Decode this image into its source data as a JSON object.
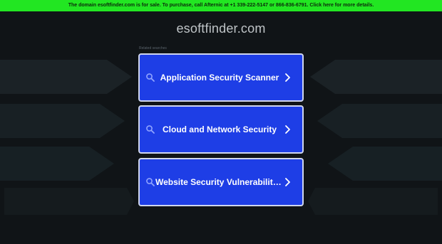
{
  "banner": {
    "text": "The domain esoftfinder.com is for sale. To purchase, call Afternic at +1 339-222-5147 or 866-836-6791. Click here for more details."
  },
  "site": {
    "title": "esoftfinder.com"
  },
  "related": {
    "label": "Related searches",
    "items": [
      {
        "label": "Application Security Scanner"
      },
      {
        "label": "Cloud and Network Security"
      },
      {
        "label": "Website Security Vulnerability…"
      }
    ]
  },
  "colors": {
    "background": "#101417",
    "banner": "#22e622",
    "button": "#1e3ee6",
    "button_border": "#cfd6ee",
    "decor": "#1b2225"
  },
  "icons": {
    "search": "search-icon",
    "chevron": "chevron-right-icon"
  }
}
